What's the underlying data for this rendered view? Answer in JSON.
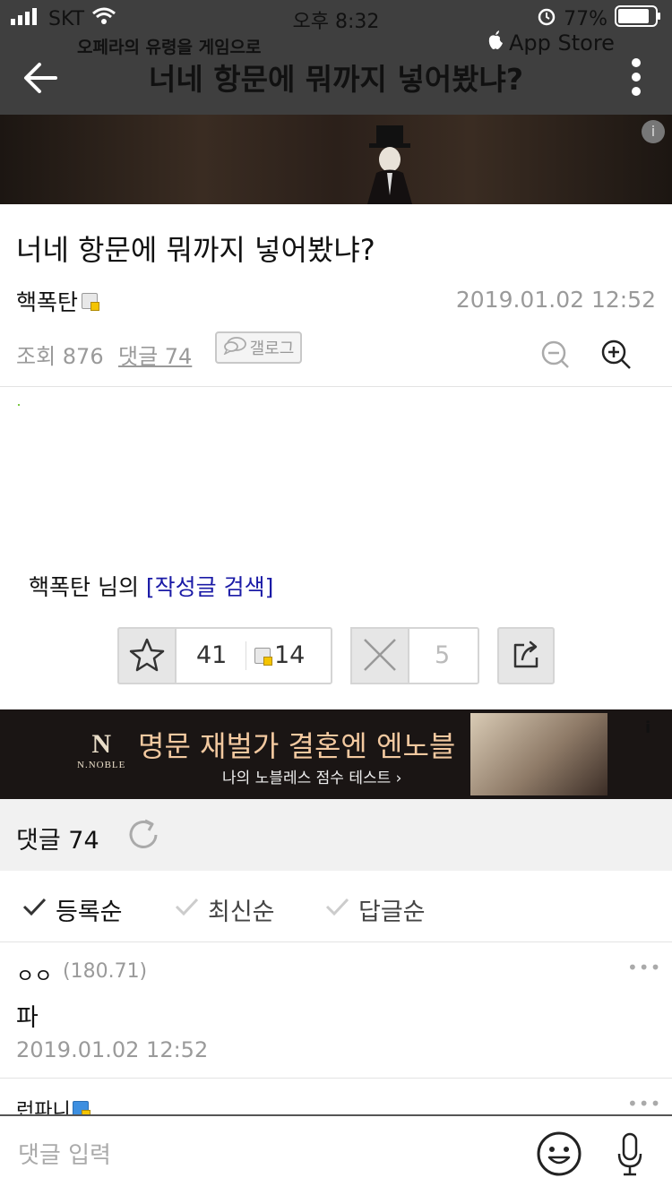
{
  "status_bar": {
    "carrier": "SKT",
    "time": "오후 8:32",
    "battery": "77%"
  },
  "nav": {
    "title": "너네 항문에 뭐까지 넣어봤냐?"
  },
  "banner": {
    "text": "오페라의 유령을 게임으로",
    "store": "App Store",
    "info": "i"
  },
  "post": {
    "title": "너네 항문에 뭐까지 넣어봤냐?",
    "author": "핵폭탄",
    "date": "2019.01.02 12:52",
    "views_label": "조회 876",
    "comments_label": "댓글 74",
    "gallog_label": "갤로그",
    "search_prefix": "핵폭탄 님의 ",
    "search_link": "[작성글 검색]"
  },
  "votes": {
    "recommend": "41",
    "fixed_recommend": "14",
    "not_recommend": "5"
  },
  "ad": {
    "logo": "N",
    "logo_text": "N.NOBLE",
    "headline": "명문 재벌가 결혼엔 엔노블",
    "sub": "나의 노블레스 점수 테스트 ›",
    "info": "i"
  },
  "comments": {
    "header": "댓글 74",
    "sort": [
      "등록순",
      "최신순",
      "답글순"
    ],
    "items": [
      {
        "name": "ㅇㅇ",
        "ip": "(180.71)",
        "body": "파",
        "date": "2019.01.02 12:52",
        "more": "•••"
      },
      {
        "name": "런파니",
        "more": "•••"
      }
    ]
  },
  "input": {
    "placeholder": "댓글 입력"
  }
}
